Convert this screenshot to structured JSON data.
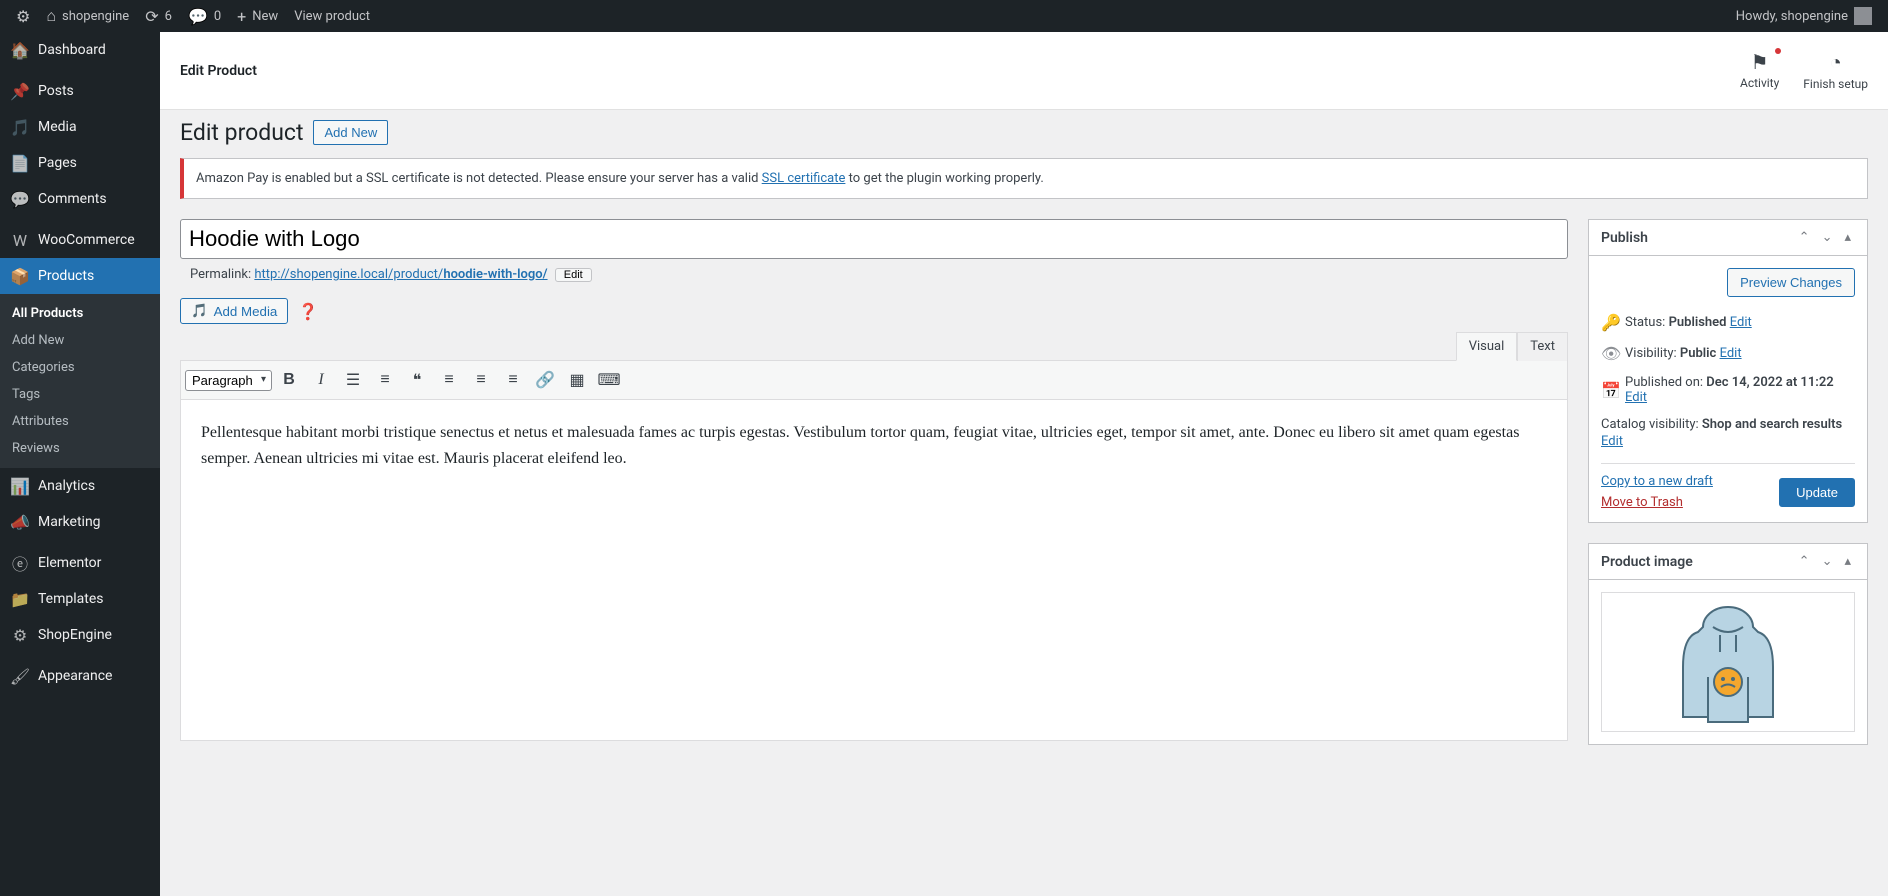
{
  "adminbar": {
    "site_name": "shopengine",
    "updates_count": "6",
    "comments_count": "0",
    "new_label": "New",
    "view_label": "View product",
    "howdy": "Howdy, shopengine"
  },
  "sidebar": {
    "dashboard": "Dashboard",
    "posts": "Posts",
    "media": "Media",
    "pages": "Pages",
    "comments": "Comments",
    "woocommerce": "WooCommerce",
    "products": "Products",
    "submenu": {
      "all_products": "All Products",
      "add_new": "Add New",
      "categories": "Categories",
      "tags": "Tags",
      "attributes": "Attributes",
      "reviews": "Reviews"
    },
    "analytics": "Analytics",
    "marketing": "Marketing",
    "elementor": "Elementor",
    "templates": "Templates",
    "shopengine": "ShopEngine",
    "appearance": "Appearance"
  },
  "header": {
    "page_title": "Edit Product",
    "activity": "Activity",
    "finish_setup": "Finish setup"
  },
  "title_row": {
    "heading": "Edit product",
    "add_new": "Add New"
  },
  "notice": {
    "prefix": "Amazon Pay is enabled but a SSL certificate is not detected. Please ensure your server has a valid ",
    "link": "SSL certificate",
    "suffix": " to get the plugin working properly."
  },
  "product": {
    "title": "Hoodie with Logo",
    "permalink_label": "Permalink:",
    "permalink_base": "http://shopengine.local/product/",
    "permalink_slug": "hoodie-with-logo/",
    "edit_btn": "Edit",
    "description": "Pellentesque habitant morbi tristique senectus et netus et malesuada fames ac turpis egestas. Vestibulum tortor quam, feugiat vitae, ultricies eget, tempor sit amet, ante. Donec eu libero sit amet quam egestas semper. Aenean ultricies mi vitae est. Mauris placerat eleifend leo."
  },
  "editor": {
    "add_media": "Add Media",
    "visual_tab": "Visual",
    "text_tab": "Text",
    "format_select": "Paragraph"
  },
  "publish": {
    "box_title": "Publish",
    "preview_changes": "Preview Changes",
    "status_label": "Status:",
    "status_value": "Published",
    "visibility_label": "Visibility:",
    "visibility_value": "Public",
    "published_label": "Published on:",
    "published_value": "Dec 14, 2022 at 11:22",
    "catalog_label": "Catalog visibility:",
    "catalog_value": "Shop and search results",
    "edit_link": "Edit",
    "copy_draft": "Copy to a new draft",
    "move_trash": "Move to Trash",
    "update_btn": "Update"
  },
  "product_image": {
    "box_title": "Product image"
  }
}
